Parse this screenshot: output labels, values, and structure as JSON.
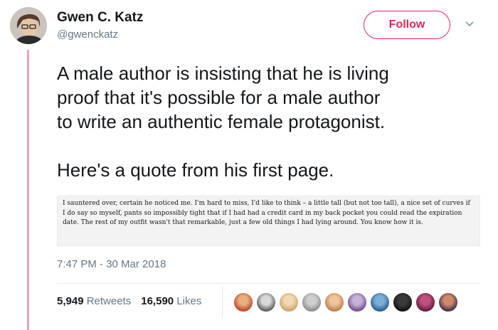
{
  "author": {
    "name": "Gwen C. Katz",
    "handle": "@gwenckatz"
  },
  "follow_button": {
    "label": "Follow"
  },
  "tweet": {
    "paragraph1": "A male author is insisting that he is living\nproof that it's possible for a male author\nto write an authentic female protagonist.",
    "paragraph2": "Here's a quote from his first page."
  },
  "quote_image": {
    "text": "I sauntered over, certain he noticed me. I'm hard to miss, I'd like to think – a little tall (but not too tall), a nice set of curves if I do say so myself, pants so impossibly tight that if I had had a credit card in my back pocket you could read the expiration date. The rest of my outfit wasn't that remarkable, just a few old things I had lying around. You know how it is."
  },
  "timestamp": "7:47 PM - 30 Mar 2018",
  "stats": {
    "retweets_count": "5,949",
    "retweets_label": "Retweets",
    "likes_count": "16,590",
    "likes_label": "Likes"
  },
  "colors": {
    "accent": "#e0245e",
    "thread_line": "#e3a8ae",
    "secondary_text": "#657786"
  }
}
